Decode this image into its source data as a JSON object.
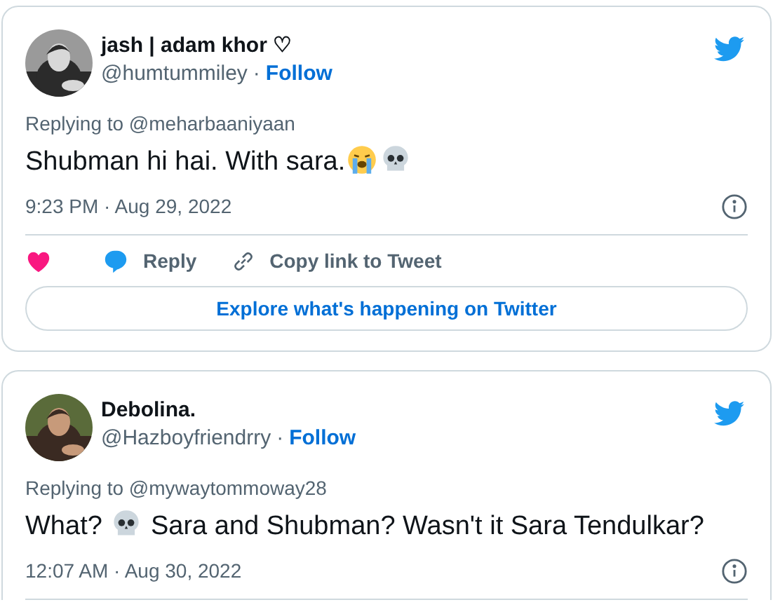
{
  "tweets": [
    {
      "name": "jash | adam khor ♡",
      "handle": "@humtummiley",
      "separator": "·",
      "follow": "Follow",
      "replying": "Replying to @meharbaaniyaan",
      "content": [
        {
          "kind": "text",
          "text": "Shubman hi hai. With sara."
        },
        {
          "kind": "crying"
        },
        {
          "kind": "skull"
        }
      ],
      "time": "9:23 PM · Aug 29, 2022",
      "actions": {
        "reply": "Reply",
        "copy": "Copy link to Tweet"
      },
      "explore": "Explore what's happening on Twitter"
    },
    {
      "name": "Debolina.",
      "handle": "@Hazboyfriendrry",
      "separator": "·",
      "follow": "Follow",
      "replying": "Replying to @mywaytommoway28",
      "content": [
        {
          "kind": "text",
          "text": "What? "
        },
        {
          "kind": "skull"
        },
        {
          "kind": "text",
          "text": " Sara and Shubman? Wasn't it Sara Tendulkar?"
        }
      ],
      "time": "12:07 AM · Aug 30, 2022"
    }
  ]
}
